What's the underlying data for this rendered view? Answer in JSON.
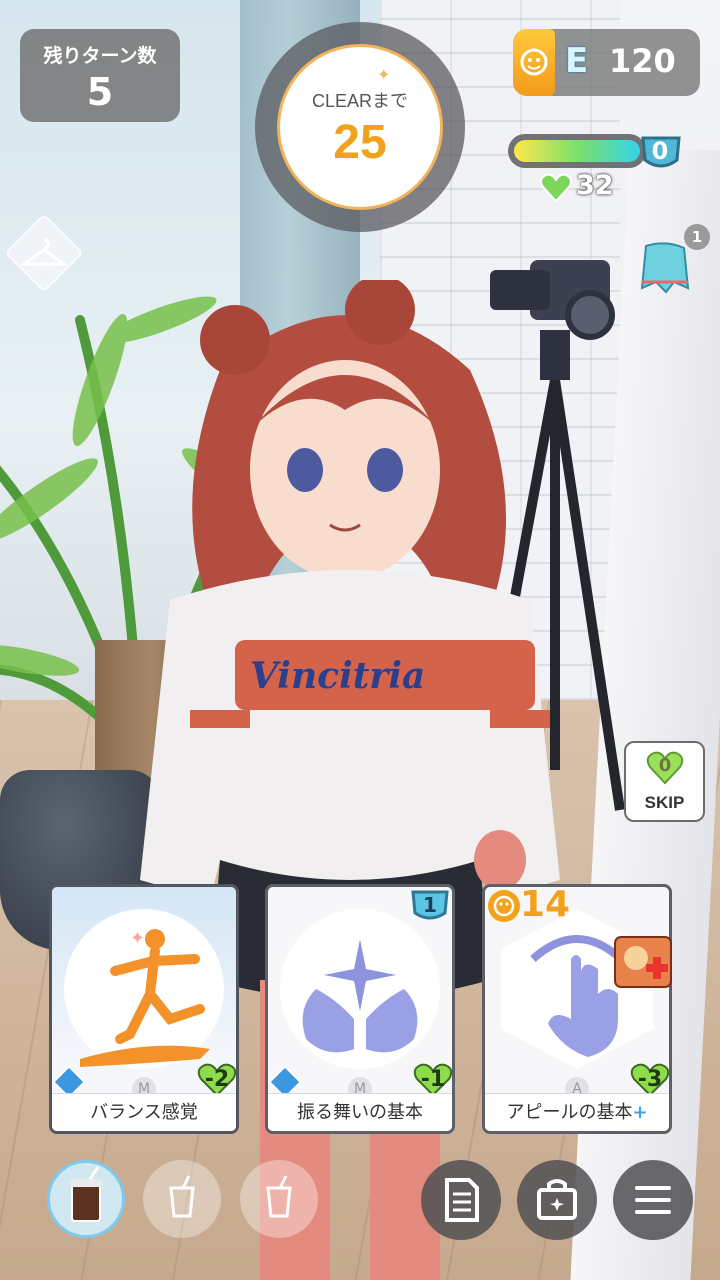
{
  "hud": {
    "turns_label": "残りターン数",
    "turns_value": "5",
    "clear_label": "CLEARまで",
    "clear_value": "25",
    "energy_letter": "E",
    "energy_value": "120",
    "gauge_value": "0",
    "gauge_fill_fraction": 1.0,
    "stamina_value": "32",
    "towel_count": "1",
    "skip_cost": "0",
    "skip_label": "SKIP"
  },
  "cards": [
    {
      "name": "バランス感覚",
      "plus": "",
      "cost": "-2",
      "type_letter": "M"
    },
    {
      "name": "振る舞いの基本",
      "plus": "",
      "cost": "-1",
      "type_letter": "M",
      "level": "1"
    },
    {
      "name": "アピールの基本",
      "plus": "+",
      "cost": "-3",
      "type_letter": "A",
      "appeal": "14"
    }
  ],
  "colors": {
    "accent_orange": "#f0a21d",
    "heart_green": "#7cd65a",
    "card_purple": "#9aa0e6",
    "silhouette_orange": "#f3922a"
  }
}
